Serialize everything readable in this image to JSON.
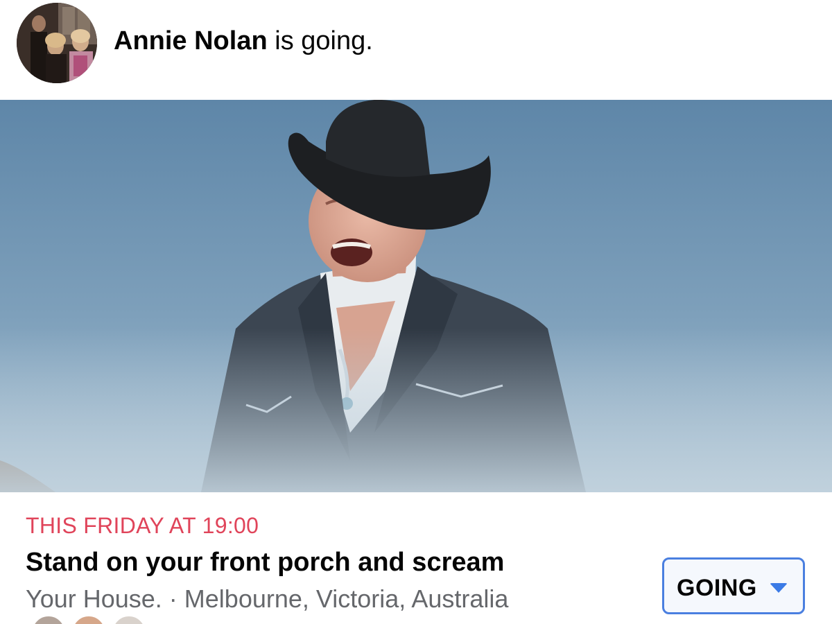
{
  "header": {
    "user_name": "Annie Nolan",
    "status_text": " is going."
  },
  "event": {
    "date_time": "THIS FRIDAY AT 19:00",
    "title": "Stand on your front porch and scream",
    "location": "Your House. · Melbourne, Victoria, Australia"
  },
  "rsvp": {
    "label": "GOING",
    "icon": "caret-down-icon"
  },
  "colors": {
    "date_accent": "#e0445a",
    "button_border": "#4a7fe0",
    "caret": "#3b7be6",
    "secondary_text": "#65676b"
  }
}
